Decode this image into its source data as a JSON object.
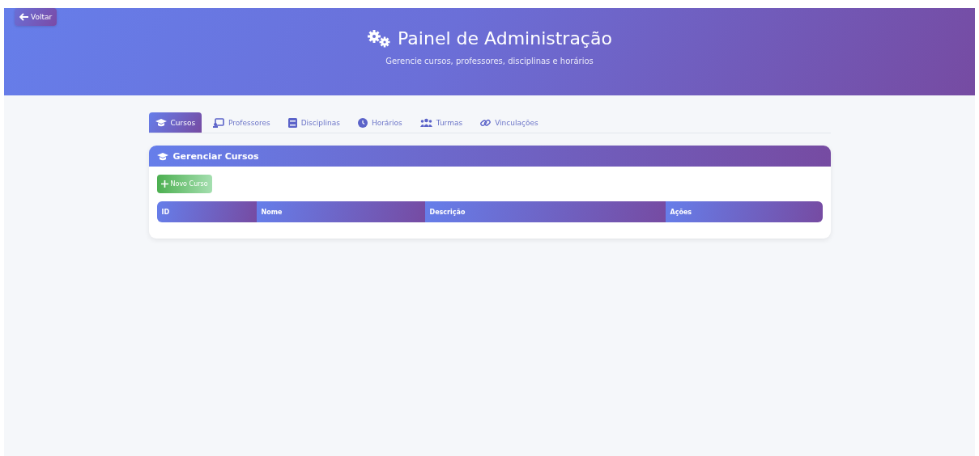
{
  "back_button": {
    "label": "Voltar"
  },
  "header": {
    "title": "Painel de Administração",
    "subtitle": "Gerencie cursos, professores, disciplinas e horários"
  },
  "tabs": [
    {
      "label": "Cursos",
      "selected": true
    },
    {
      "label": "Professores",
      "selected": false
    },
    {
      "label": "Disciplinas",
      "selected": false
    },
    {
      "label": "Horários",
      "selected": false
    },
    {
      "label": "Turmas",
      "selected": false
    },
    {
      "label": "Vinculações",
      "selected": false
    }
  ],
  "panel": {
    "title": "Gerenciar Cursos",
    "new_button": "Novo Curso",
    "table": {
      "columns": [
        "ID",
        "Nome",
        "Descrição",
        "Ações"
      ]
    }
  }
}
